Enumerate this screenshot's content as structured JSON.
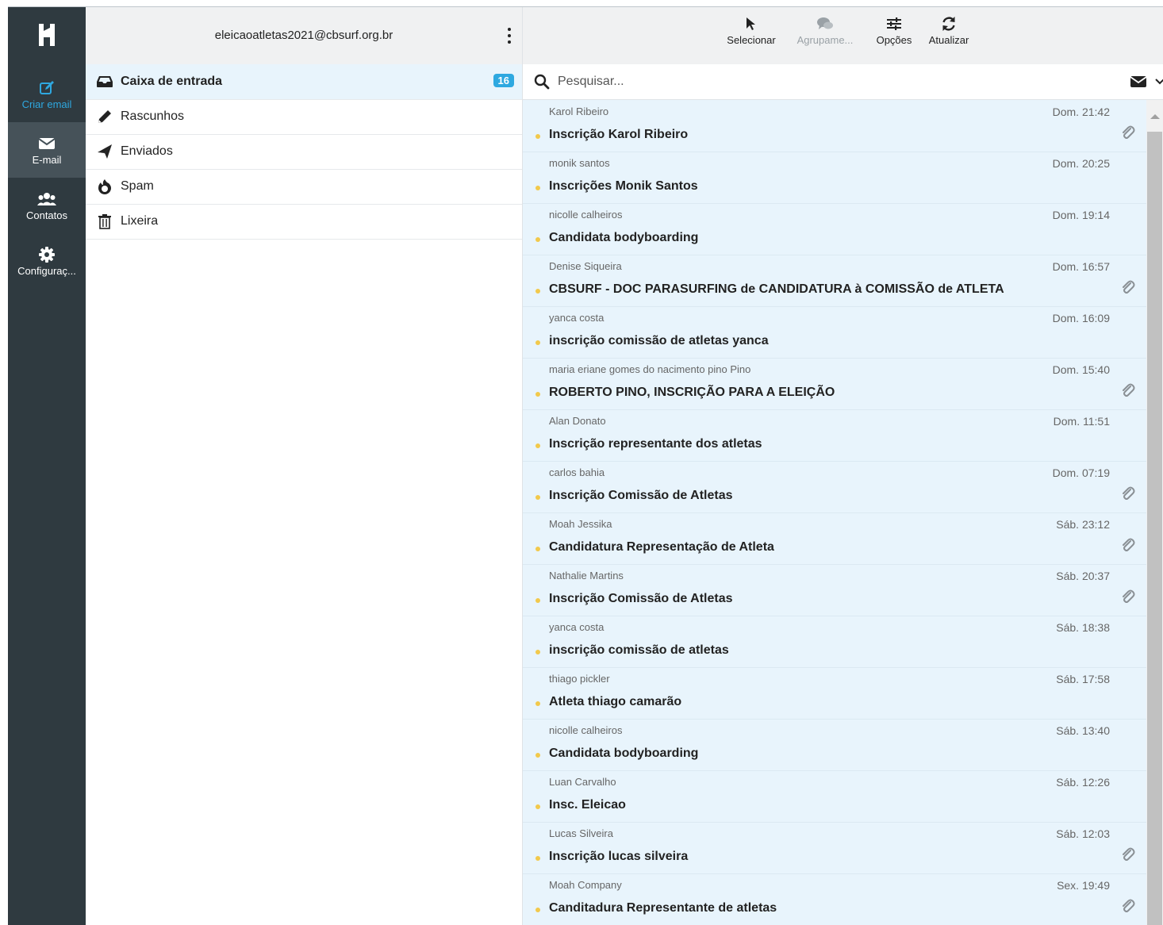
{
  "rail": {
    "compose_label": "Criar email",
    "mail_label": "E-mail",
    "contacts_label": "Contatos",
    "settings_label": "Configuraç..."
  },
  "account": {
    "email": "eleicaoatletas2021@cbsurf.org.br"
  },
  "folders": [
    {
      "label": "Caixa de entrada",
      "icon": "inbox-icon",
      "count": "16"
    },
    {
      "label": "Rascunhos",
      "icon": "pencil-icon"
    },
    {
      "label": "Enviados",
      "icon": "send-icon"
    },
    {
      "label": "Spam",
      "icon": "fire-icon"
    },
    {
      "label": "Lixeira",
      "icon": "trash-icon"
    }
  ],
  "toolbar": {
    "select_label": "Selecionar",
    "group_label": "Agrupame...",
    "options_label": "Opções",
    "refresh_label": "Atualizar"
  },
  "search": {
    "placeholder": "Pesquisar..."
  },
  "colors": {
    "rail_bg": "#2f3a40",
    "accent": "#2ea8e0",
    "list_bg": "#e8f4fc",
    "unread_dot": "#f2c94c"
  },
  "messages": [
    {
      "sender": "Karol Ribeiro",
      "time": "Dom. 21:42",
      "subject": "Inscrição Karol Ribeiro",
      "attachment": true
    },
    {
      "sender": "monik santos",
      "time": "Dom. 20:25",
      "subject": "Inscrições Monik Santos",
      "attachment": false
    },
    {
      "sender": "nicolle calheiros",
      "time": "Dom. 19:14",
      "subject": "Candidata bodyboarding",
      "attachment": false
    },
    {
      "sender": "Denise Siqueira",
      "time": "Dom. 16:57",
      "subject": "CBSURF - DOC PARASURFING de CANDIDATURA à COMISSÃO de ATLETA",
      "attachment": true
    },
    {
      "sender": "yanca costa",
      "time": "Dom. 16:09",
      "subject": "inscrição comissão de atletas yanca",
      "attachment": false
    },
    {
      "sender": "maria eriane gomes do nacimento pino Pino",
      "time": "Dom. 15:40",
      "subject": "ROBERTO PINO, INSCRIÇÃO PARA A ELEIÇÃO",
      "attachment": true
    },
    {
      "sender": "Alan Donato",
      "time": "Dom. 11:51",
      "subject": "Inscrição representante dos atletas",
      "attachment": false
    },
    {
      "sender": "carlos bahia",
      "time": "Dom. 07:19",
      "subject": "Inscrição Comissão de Atletas",
      "attachment": true
    },
    {
      "sender": "Moah Jessika",
      "time": "Sáb. 23:12",
      "subject": "Candidatura Representação de Atleta",
      "attachment": true
    },
    {
      "sender": "Nathalie Martins",
      "time": "Sáb. 20:37",
      "subject": "Inscrição Comissão de Atletas",
      "attachment": true
    },
    {
      "sender": "yanca costa",
      "time": "Sáb. 18:38",
      "subject": "inscrição comissão de atletas",
      "attachment": false
    },
    {
      "sender": "thiago pickler",
      "time": "Sáb. 17:58",
      "subject": "Atleta thiago camarão",
      "attachment": false
    },
    {
      "sender": "nicolle calheiros",
      "time": "Sáb. 13:40",
      "subject": "Candidata bodyboarding",
      "attachment": false
    },
    {
      "sender": "Luan Carvalho",
      "time": "Sáb. 12:26",
      "subject": "Insc. Eleicao",
      "attachment": false
    },
    {
      "sender": "Lucas Silveira",
      "time": "Sáb. 12:03",
      "subject": "Inscrição lucas silveira",
      "attachment": true
    },
    {
      "sender": "Moah Company",
      "time": "Sex. 19:49",
      "subject": "Canditadura Representante de atletas",
      "attachment": true
    }
  ]
}
